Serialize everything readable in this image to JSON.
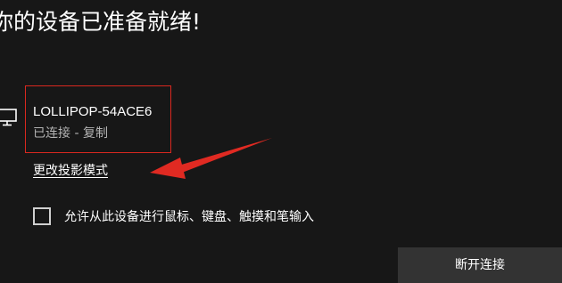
{
  "header": {
    "title": "你的设备已准备就绪!"
  },
  "device": {
    "icon": "monitor-icon",
    "name": "LOLLIPOP-54ACE6",
    "status": "已连接 - 复制",
    "highlight_color": "#d9281f"
  },
  "actions": {
    "change_projection_mode": "更改投影模式",
    "allow_input_label": "允许从此设备进行鼠标、键盘、触摸和笔输入",
    "allow_input_checked": false,
    "disconnect": "断开连接"
  },
  "annotation": {
    "arrow_color": "#e02a22"
  }
}
